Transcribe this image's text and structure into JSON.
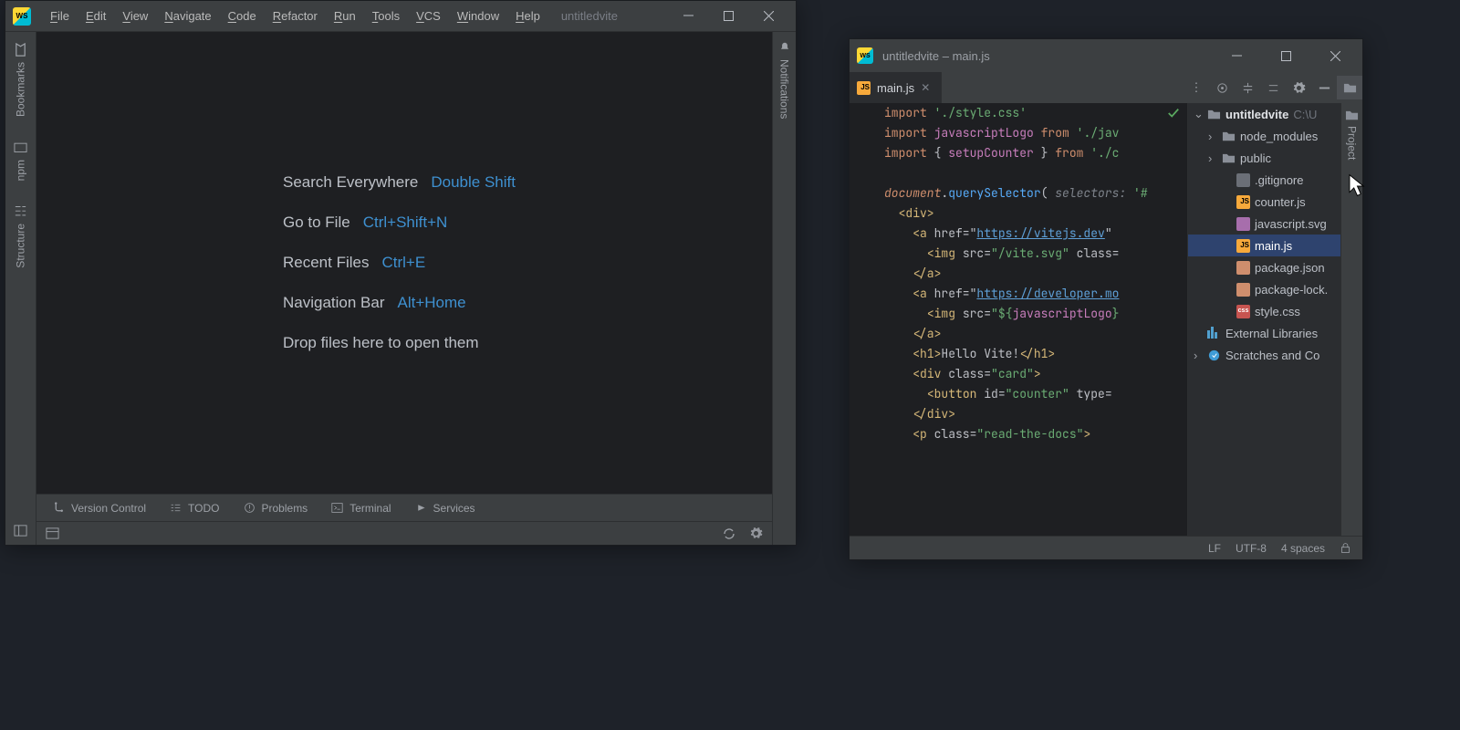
{
  "w1": {
    "menus": [
      "File",
      "Edit",
      "View",
      "Navigate",
      "Code",
      "Refactor",
      "Run",
      "Tools",
      "VCS",
      "Window",
      "Help"
    ],
    "title": "untitledvite",
    "welcome": [
      {
        "label": "Search Everywhere",
        "shortcut": "Double Shift"
      },
      {
        "label": "Go to File",
        "shortcut": "Ctrl+Shift+N"
      },
      {
        "label": "Recent Files",
        "shortcut": "Ctrl+E"
      },
      {
        "label": "Navigation Bar",
        "shortcut": "Alt+Home"
      },
      {
        "label": "Drop files here to open them",
        "shortcut": ""
      }
    ],
    "leftrail": {
      "bookmarks": "Bookmarks",
      "npm": "npm",
      "structure": "Structure"
    },
    "rightrail": {
      "notifications": "Notifications"
    },
    "bottomtools": [
      "Version Control",
      "TODO",
      "Problems",
      "Terminal",
      "Services"
    ]
  },
  "w2": {
    "title": "untitledvite – main.js",
    "tab": "main.js",
    "status": {
      "lf": "LF",
      "enc": "UTF-8",
      "indent": "4 spaces"
    },
    "project": {
      "root": "untitledvite",
      "rootPath": "C:\\U",
      "items": [
        {
          "name": "node_modules",
          "kind": "folder",
          "indent": 1,
          "expandable": true
        },
        {
          "name": "public",
          "kind": "folder",
          "indent": 1,
          "expandable": true
        },
        {
          "name": ".gitignore",
          "kind": "txt",
          "indent": 2
        },
        {
          "name": "counter.js",
          "kind": "js",
          "indent": 2
        },
        {
          "name": "javascript.svg",
          "kind": "svg",
          "indent": 2
        },
        {
          "name": "main.js",
          "kind": "js",
          "indent": 2,
          "selected": true
        },
        {
          "name": "package.json",
          "kind": "json",
          "indent": 2
        },
        {
          "name": "package-lock.",
          "kind": "json",
          "indent": 2
        },
        {
          "name": "style.css",
          "kind": "css",
          "indent": 2
        }
      ],
      "external": "External Libraries",
      "scratches": "Scratches and Co"
    },
    "rightrail": "Project",
    "code": [
      [
        [
          "kw",
          "import "
        ],
        [
          "str",
          "'./style.css'"
        ]
      ],
      [
        [
          "kw",
          "import "
        ],
        [
          "id",
          "javascriptLogo"
        ],
        [
          "txt",
          " "
        ],
        [
          "kw",
          "from "
        ],
        [
          "str",
          "'./jav"
        ]
      ],
      [
        [
          "kw",
          "import "
        ],
        [
          "txt",
          "{ "
        ],
        [
          "id",
          "setupCounter"
        ],
        [
          "txt",
          " } "
        ],
        [
          "kw",
          "from "
        ],
        [
          "str",
          "'./c"
        ]
      ],
      [],
      [
        [
          "doc",
          "document"
        ],
        [
          "txt",
          "."
        ],
        [
          "fn",
          "querySelector"
        ],
        [
          "txt",
          "( "
        ],
        [
          "hint",
          "selectors: "
        ],
        [
          "str",
          "'#"
        ]
      ],
      [
        [
          "txt",
          "  "
        ],
        [
          "tag",
          "<div>"
        ]
      ],
      [
        [
          "txt",
          "    "
        ],
        [
          "tag",
          "<a "
        ],
        [
          "txt",
          "href=\""
        ],
        [
          "lnk",
          "https://vitejs.dev"
        ],
        [
          "txt",
          "\""
        ]
      ],
      [
        [
          "txt",
          "      "
        ],
        [
          "tag",
          "<img "
        ],
        [
          "txt",
          "src="
        ],
        [
          "str",
          "\"/vite.svg\""
        ],
        [
          "txt",
          " class="
        ]
      ],
      [
        [
          "txt",
          "    "
        ],
        [
          "tag",
          "</a>"
        ]
      ],
      [
        [
          "txt",
          "    "
        ],
        [
          "tag",
          "<a "
        ],
        [
          "txt",
          "href=\""
        ],
        [
          "lnk",
          "https://developer.mo"
        ]
      ],
      [
        [
          "txt",
          "      "
        ],
        [
          "tag",
          "<img "
        ],
        [
          "txt",
          "src="
        ],
        [
          "str",
          "\"${"
        ],
        [
          "id",
          "javascriptLogo"
        ],
        [
          "str",
          "}"
        ]
      ],
      [
        [
          "txt",
          "    "
        ],
        [
          "tag",
          "</a>"
        ]
      ],
      [
        [
          "txt",
          "    "
        ],
        [
          "tag",
          "<h1>"
        ],
        [
          "txt",
          "Hello Vite!"
        ],
        [
          "tag",
          "</h1>"
        ]
      ],
      [
        [
          "txt",
          "    "
        ],
        [
          "tag",
          "<div "
        ],
        [
          "txt",
          "class="
        ],
        [
          "str",
          "\"card\""
        ],
        [
          "tag",
          ">"
        ]
      ],
      [
        [
          "txt",
          "      "
        ],
        [
          "tag",
          "<button "
        ],
        [
          "txt",
          "id="
        ],
        [
          "str",
          "\"counter\""
        ],
        [
          "txt",
          " type="
        ]
      ],
      [
        [
          "txt",
          "    "
        ],
        [
          "tag",
          "</div>"
        ]
      ],
      [
        [
          "txt",
          "    "
        ],
        [
          "tag",
          "<p "
        ],
        [
          "txt",
          "class="
        ],
        [
          "str",
          "\"read-the-docs\""
        ],
        [
          "tag",
          ">"
        ]
      ]
    ]
  }
}
